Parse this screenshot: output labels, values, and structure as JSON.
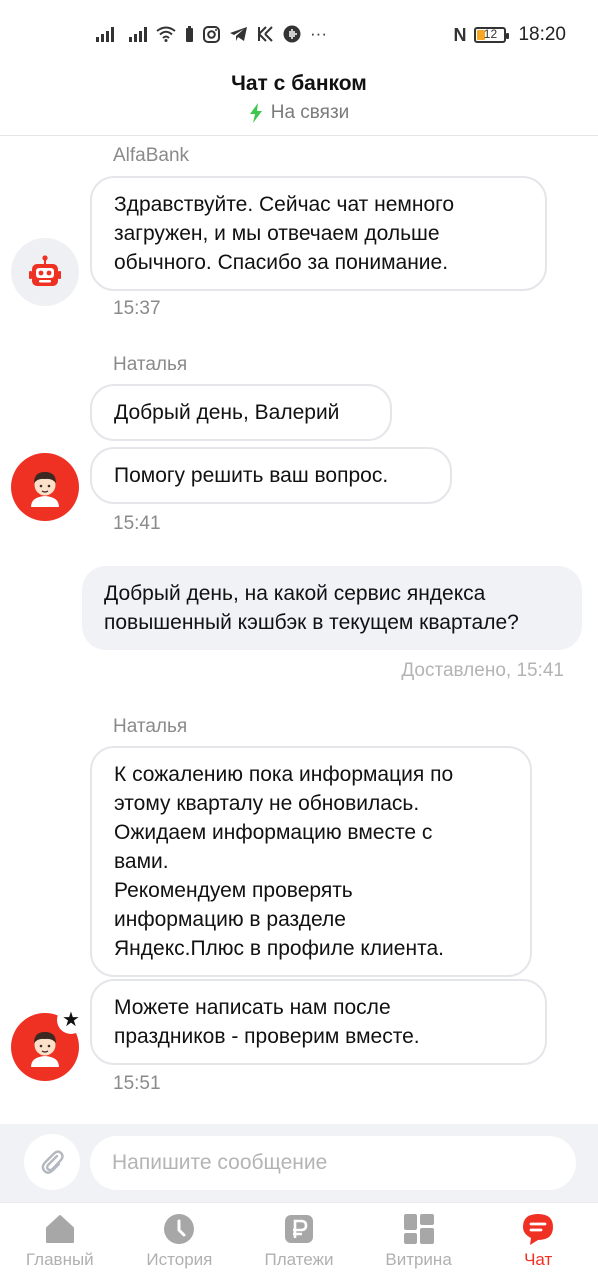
{
  "status_bar": {
    "time": "18:20",
    "battery_level": "12",
    "nfc": "N",
    "more": "···",
    "icons": [
      "signal-icon",
      "signal-icon",
      "wifi-icon",
      "battery-small-icon",
      "instagram-icon",
      "telegram-icon",
      "kaspersky-icon",
      "voice-icon",
      "more-icon",
      "nfc-icon",
      "battery-icon"
    ]
  },
  "header": {
    "title": "Чат с банком",
    "status": "На связи",
    "accent_color": "#3ec84e"
  },
  "messages": [
    {
      "author": "AlfaBank",
      "avatar": "robot-icon",
      "bubbles": [
        "Здравствуйте. Сейчас чат немного\nзагружен, и мы отвечаем дольше\nобычного. Спасибо за понимание."
      ],
      "time": "15:37"
    },
    {
      "author": "Наталья",
      "avatar": "person-icon",
      "bubbles": [
        "Добрый  день, Валерий",
        "Помогу  решить  ваш вопрос."
      ],
      "time": "15:41"
    },
    {
      "outgoing": true,
      "text": "Добрый день, на какой сервис яндекса\nповышенный кэшбэк в текущем квартале?",
      "status": "Доставлено, 15:41"
    },
    {
      "author": "Наталья",
      "avatar": "person-icon",
      "bubbles": [
        "К сожалению пока  информация  по\nэтому   кварталу  не обновилась.\nОжидаем информацию  вместе  с\nвами.\nРекомендуем проверять\nинформацию в  разделе\nЯндекс.Плюс в профиле клиента.",
        "Можете  написать  нам  после\nпраздников - проверим вместе."
      ],
      "time": "15:51",
      "badge": "★"
    }
  ],
  "composer": {
    "placeholder": "Напишите сообщение",
    "attach_icon": "paperclip-icon"
  },
  "bottom_nav": {
    "active_color": "#ef3124",
    "items": [
      {
        "label": "Главный",
        "icon": "home-icon"
      },
      {
        "label": "История",
        "icon": "clock-icon"
      },
      {
        "label": "Платежи",
        "icon": "ruble-icon"
      },
      {
        "label": "Витрина",
        "icon": "grid-icon"
      },
      {
        "label": "Чат",
        "icon": "chat-icon",
        "active": true
      }
    ]
  }
}
